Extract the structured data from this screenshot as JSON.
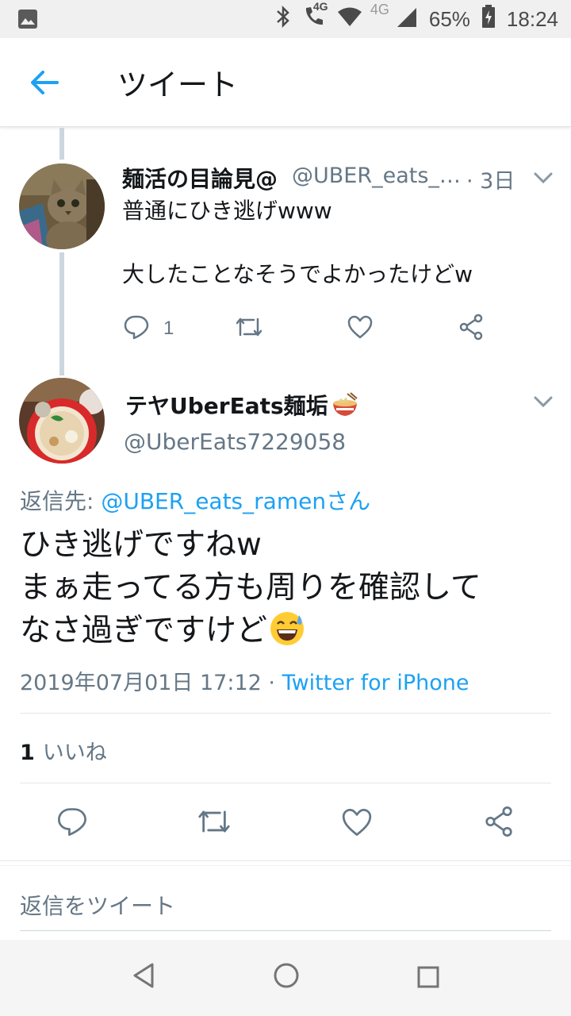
{
  "status_bar": {
    "network_4g_call": "4G",
    "network_4g": "4G",
    "battery": "65%",
    "time": "18:24"
  },
  "header": {
    "title": "ツイート"
  },
  "parent_tweet": {
    "display_name": "麺活の目論見@",
    "handle": "@UBER_eats_…",
    "time": "· 3日",
    "body": "普通にひき逃げwww\n\n大したことなそうでよかったけどw",
    "reply_count": "1"
  },
  "main_tweet": {
    "display_name": "テヤUberEats麺垢",
    "handle": "@UberEats7229058",
    "reply_label": "返信先:",
    "reply_mention": "@UBER_eats_ramenさん",
    "body_line1": "ひき逃げですねw",
    "body_line2": "まぁ走ってる方も周りを確認して",
    "body_line3": "なさ過ぎですけど",
    "date": "2019年07月01日 17:12 · ",
    "client": "Twitter for iPhone",
    "likes_count": "1",
    "likes_label": "いいね"
  },
  "reply_box": {
    "placeholder": "返信をツイート"
  },
  "colors": {
    "accent": "#1da1f2",
    "muted": "#657786",
    "text": "#14171a",
    "thread_line": "#ccd6dd"
  }
}
